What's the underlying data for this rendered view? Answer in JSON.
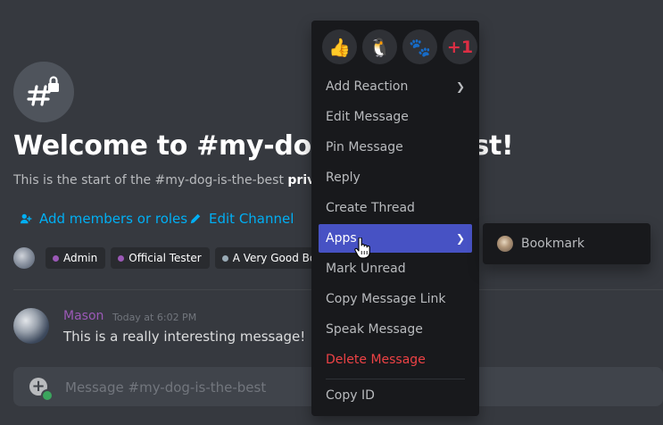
{
  "channel": {
    "title": "Welcome to #my-dog-is-the-best!",
    "subtitle_prefix": "This is the start of the #my-dog-is-the-best ",
    "subtitle_bold": "private",
    "add_members_label": "Add members or roles",
    "edit_channel_label": "Edit Channel",
    "icon": "hashtag-lock-icon"
  },
  "roles": [
    {
      "name": "Admin",
      "color": "#9b59b6"
    },
    {
      "name": "Official Tester",
      "color": "#9b59b6"
    },
    {
      "name": "A Very Good Bot",
      "color": "#99aab5"
    }
  ],
  "message": {
    "author": "Mason",
    "timestamp": "Today at 6:02 PM",
    "text": "This is a really interesting message!",
    "author_color": "#9b59b6"
  },
  "composer": {
    "placeholder": "Message #my-dog-is-the-best"
  },
  "context_menu": {
    "reactions": [
      {
        "name": "thumbs-up-emoji",
        "glyph": "👍"
      },
      {
        "name": "penguin-emoji",
        "glyph": "🐧"
      },
      {
        "name": "custom-emoji",
        "glyph": "🐾"
      },
      {
        "name": "plus-one-emoji",
        "glyph": "+1"
      }
    ],
    "items": [
      {
        "label": "Add Reaction",
        "has_submenu": true
      },
      {
        "label": "Edit Message"
      },
      {
        "label": "Pin Message"
      },
      {
        "label": "Reply"
      },
      {
        "label": "Create Thread"
      },
      {
        "label": "Apps",
        "has_submenu": true,
        "active": true
      },
      {
        "label": "Mark Unread"
      },
      {
        "label": "Copy Message Link"
      },
      {
        "label": "Speak Message"
      },
      {
        "label": "Delete Message",
        "danger": true
      },
      {
        "label": "Copy ID"
      }
    ]
  },
  "apps_submenu": {
    "items": [
      {
        "label": "Bookmark"
      }
    ]
  },
  "colors": {
    "background": "#36393f",
    "menu_background": "#18191c",
    "active_item": "#4752c4",
    "link": "#00aff4",
    "danger": "#ed4245"
  }
}
